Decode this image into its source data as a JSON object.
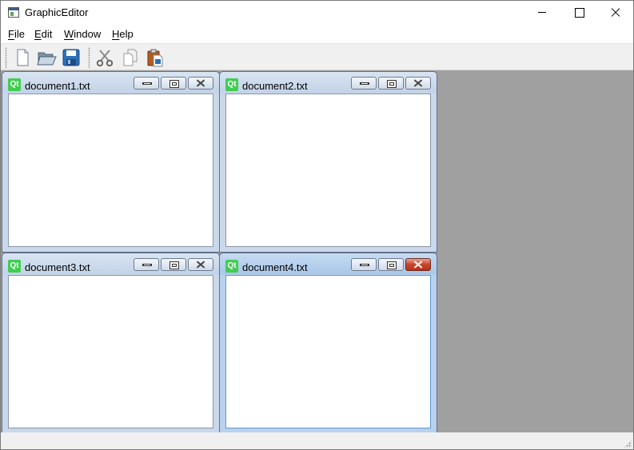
{
  "window": {
    "title": "GraphicEditor",
    "icon": "app-window-icon",
    "controls": [
      "minimize-icon",
      "maximize-icon",
      "close-icon"
    ]
  },
  "menubar": {
    "items": [
      {
        "label": "File"
      },
      {
        "label": "Edit"
      },
      {
        "label": "Window"
      },
      {
        "label": "Help"
      }
    ]
  },
  "toolbar": {
    "buttons": [
      {
        "icon": "new-file-icon"
      },
      {
        "icon": "open-folder-icon"
      },
      {
        "icon": "save-icon"
      },
      {
        "icon": "cut-icon"
      },
      {
        "icon": "copy-icon"
      },
      {
        "icon": "paste-icon"
      }
    ]
  },
  "mdi": {
    "background": "#a0a0a0",
    "subwindows": [
      {
        "title": "document1.txt",
        "icon_text": "Qt",
        "active": false
      },
      {
        "title": "document2.txt",
        "icon_text": "Qt",
        "active": false
      },
      {
        "title": "document3.txt",
        "icon_text": "Qt",
        "active": false
      },
      {
        "title": "document4.txt",
        "icon_text": "Qt",
        "active": true
      }
    ]
  },
  "colors": {
    "qt_green": "#41cd52",
    "active_close": "#c7432a",
    "active_border": "#5b9bd5"
  }
}
